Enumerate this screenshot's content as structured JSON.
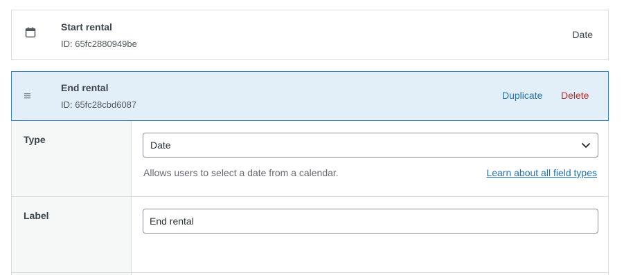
{
  "fields": [
    {
      "title": "Start rental",
      "id_text": "ID: 65fc2880949be",
      "type": "Date",
      "icon": "calendar-icon"
    },
    {
      "title": "End rental",
      "id_text": "ID: 65fc28cbd6087",
      "icon": "drag-handle-icon",
      "actions": {
        "duplicate": "Duplicate",
        "delete": "Delete"
      }
    }
  ],
  "settings": {
    "type": {
      "label": "Type",
      "selected": "Date",
      "help": "Allows users to select a date from a calendar.",
      "link": "Learn about all field types"
    },
    "label": {
      "label": "Label",
      "value": "End rental"
    }
  },
  "colors": {
    "accent": "#2271b1",
    "delete": "#b32d2e",
    "active_row_bg": "#e2eff8",
    "active_row_border": "#3582c4"
  }
}
